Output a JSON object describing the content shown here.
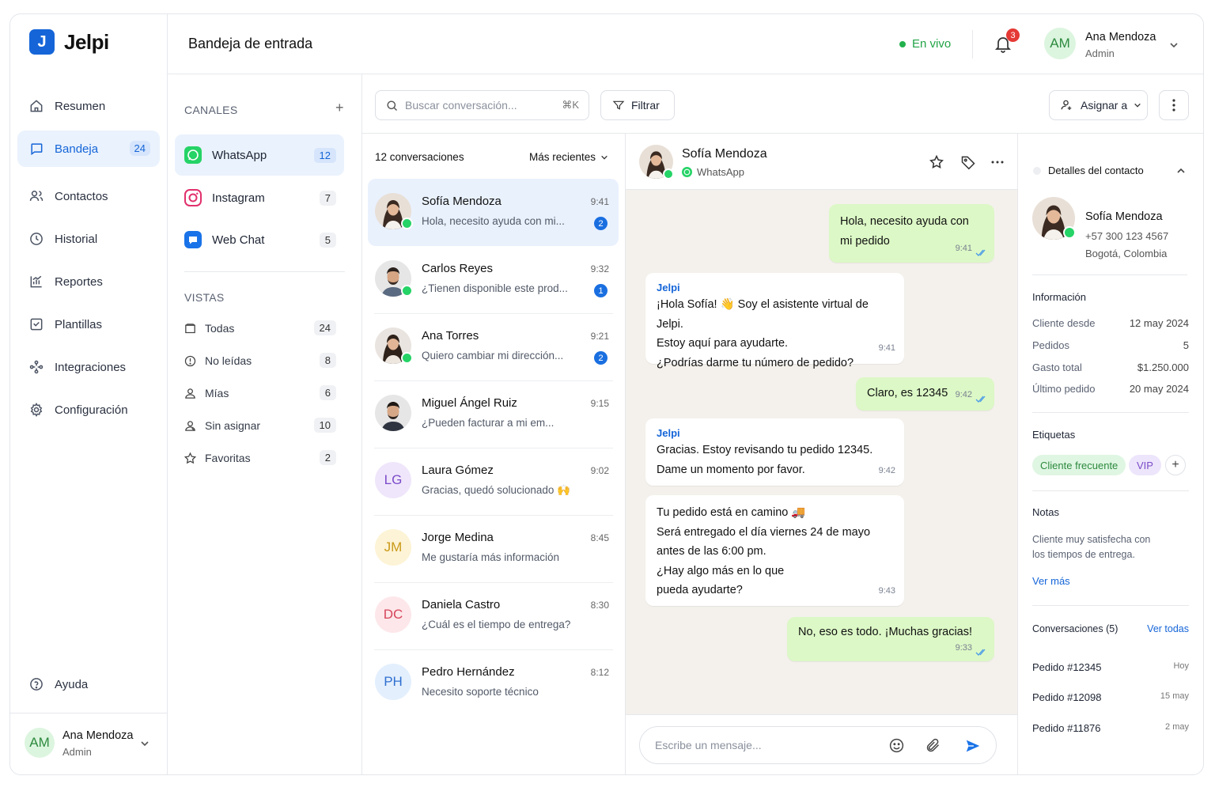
{
  "brand": {
    "logo_letter": "J",
    "name": "Jelpi",
    "accent": "#1565d8"
  },
  "sidebar": {
    "items": [
      {
        "label": "Resumen",
        "icon": "home-icon"
      },
      {
        "label": "Bandeja",
        "icon": "chat-bubble-icon",
        "count": "24",
        "active": true
      },
      {
        "label": "Contactos",
        "icon": "contacts-icon"
      },
      {
        "label": "Historial",
        "icon": "history-icon"
      },
      {
        "label": "Reportes",
        "icon": "chart-icon"
      },
      {
        "label": "Plantillas",
        "icon": "template-icon"
      },
      {
        "label": "Integraciones",
        "icon": "integrations-icon"
      },
      {
        "label": "Configuración",
        "icon": "gear-icon"
      }
    ],
    "help": "Ayuda",
    "user": {
      "initials": "AM",
      "name": "Ana Mendoza",
      "role": "Admin"
    }
  },
  "header": {
    "title": "Bandeja de entrada",
    "status": "En vivo",
    "status_color": "#22b14c",
    "notifications": "3",
    "user": {
      "initials": "AM",
      "name": "Ana Mendoza",
      "role": "Admin"
    }
  },
  "channels": {
    "title": "CANALES",
    "add": "+",
    "items": [
      {
        "label": "WhatsApp",
        "count": "12",
        "active": true,
        "color": "#25d366"
      },
      {
        "label": "Instagram",
        "count": "7",
        "color": "#e1306c"
      },
      {
        "label": "Web Chat",
        "count": "5",
        "color": "#1a73e8"
      }
    ],
    "views_title": "VISTAS",
    "views": [
      {
        "label": "Todas",
        "count": "24",
        "icon": "inbox-icon"
      },
      {
        "label": "No leídas",
        "count": "8",
        "icon": "unread-icon"
      },
      {
        "label": "Mías",
        "count": "6",
        "icon": "user-icon"
      },
      {
        "label": "Sin asignar",
        "count": "10",
        "icon": "unassigned-icon"
      },
      {
        "label": "Favoritas",
        "count": "2",
        "icon": "star-icon"
      }
    ]
  },
  "toolbar": {
    "search_placeholder": "Buscar conversación...",
    "shortcut": "⌘K",
    "filter": "Filtrar",
    "assign": "Asignar a"
  },
  "list": {
    "count_label": "12 conversaciones",
    "sort": "Más recientes",
    "conversations": [
      {
        "name": "Sofía Mendoza",
        "preview": "Hola, necesito ayuda con mi...",
        "time": "9:41",
        "unread": "2",
        "avatar": "photo-f"
      },
      {
        "name": "Carlos Reyes",
        "preview": "¿Tienen disponible este prod...",
        "time": "9:32",
        "unread": "1",
        "avatar": "photo-m"
      },
      {
        "name": "Ana Torres",
        "preview": "Quiero cambiar mi dirección...",
        "time": "9:21",
        "unread": "2",
        "avatar": "photo-f"
      },
      {
        "name": "Miguel Ángel Ruiz",
        "preview": "¿Pueden facturar a mi em...",
        "time": "9:15",
        "avatar": "photo-m2"
      },
      {
        "name": "Laura Gómez",
        "preview": "Gracias, quedó solucionado 🙌",
        "time": "9:02",
        "initials": "LG",
        "bg": "#efe6fb",
        "fg": "#7b4cc9"
      },
      {
        "name": "Jorge Medina",
        "preview": "Me gustaría más información",
        "time": "8:45",
        "initials": "JM",
        "bg": "#fdf3d6",
        "fg": "#c99a17"
      },
      {
        "name": "Daniela Castro",
        "preview": "¿Cuál es el tiempo de entrega?",
        "time": "8:30",
        "initials": "DC",
        "bg": "#fde7ea",
        "fg": "#d6455c"
      },
      {
        "name": "Pedro Hernández",
        "preview": "Necesito soporte técnico",
        "time": "8:12",
        "initials": "PH",
        "bg": "#e3effd",
        "fg": "#2f6fd0"
      }
    ]
  },
  "chat": {
    "contact": "Sofía Mendoza",
    "channel": "WhatsApp",
    "bot_name": "Jelpi",
    "messages": [
      {
        "dir": "out",
        "lines": [
          "Hola, necesito ayuda con",
          "mi pedido"
        ],
        "time": "9:41"
      },
      {
        "dir": "in",
        "bot": true,
        "lines": [
          "¡Hola Sofía! 👋 Soy el asistente virtual de Jelpi.",
          "Estoy aquí para ayudarte.",
          "¿Podrías darme tu número de pedido?"
        ],
        "time": "9:41"
      },
      {
        "dir": "out",
        "lines": [
          "Claro, es 12345"
        ],
        "time": "9:42"
      },
      {
        "dir": "in",
        "bot": true,
        "lines": [
          "Gracias. Estoy revisando tu pedido 12345.",
          "Dame un momento por favor."
        ],
        "time": "9:42"
      },
      {
        "dir": "in",
        "lines": [
          "Tu pedido está en camino 🚚",
          "Será entregado el día viernes 24 de mayo",
          "antes de las 6:00 pm.",
          "¿Hay algo más en lo que",
          "pueda ayudarte?"
        ],
        "time": "9:43"
      },
      {
        "dir": "out",
        "lines": [
          "No, eso es todo. ¡Muchas gracias!"
        ],
        "time": "9:33"
      }
    ],
    "input_placeholder": "Escribe un mensaje..."
  },
  "details": {
    "title": "Detalles del contacto",
    "name": "Sofía Mendoza",
    "phone": "+57 300 123 4567",
    "location": "Bogotá, Colombia",
    "info_title": "Información",
    "info": [
      {
        "k": "Cliente desde",
        "v": "12 may 2024"
      },
      {
        "k": "Pedidos",
        "v": "5"
      },
      {
        "k": "Gasto total",
        "v": "$1.250.000"
      },
      {
        "k": "Último pedido",
        "v": "20 may 2024"
      }
    ],
    "tags_title": "Etiquetas",
    "tags": [
      "Cliente frecuente",
      "VIP"
    ],
    "notes_title": "Notas",
    "notes": [
      "Cliente muy satisfecha con",
      "los tiempos de entrega."
    ],
    "see_more": "Ver más",
    "convs_title": "Conversaciones (5)",
    "see_all": "Ver todas",
    "orders": [
      {
        "id": "Pedido #12345",
        "when": "Hoy"
      },
      {
        "id": "Pedido #12098",
        "when": "15 may"
      },
      {
        "id": "Pedido #11876",
        "when": "2 may"
      }
    ]
  }
}
